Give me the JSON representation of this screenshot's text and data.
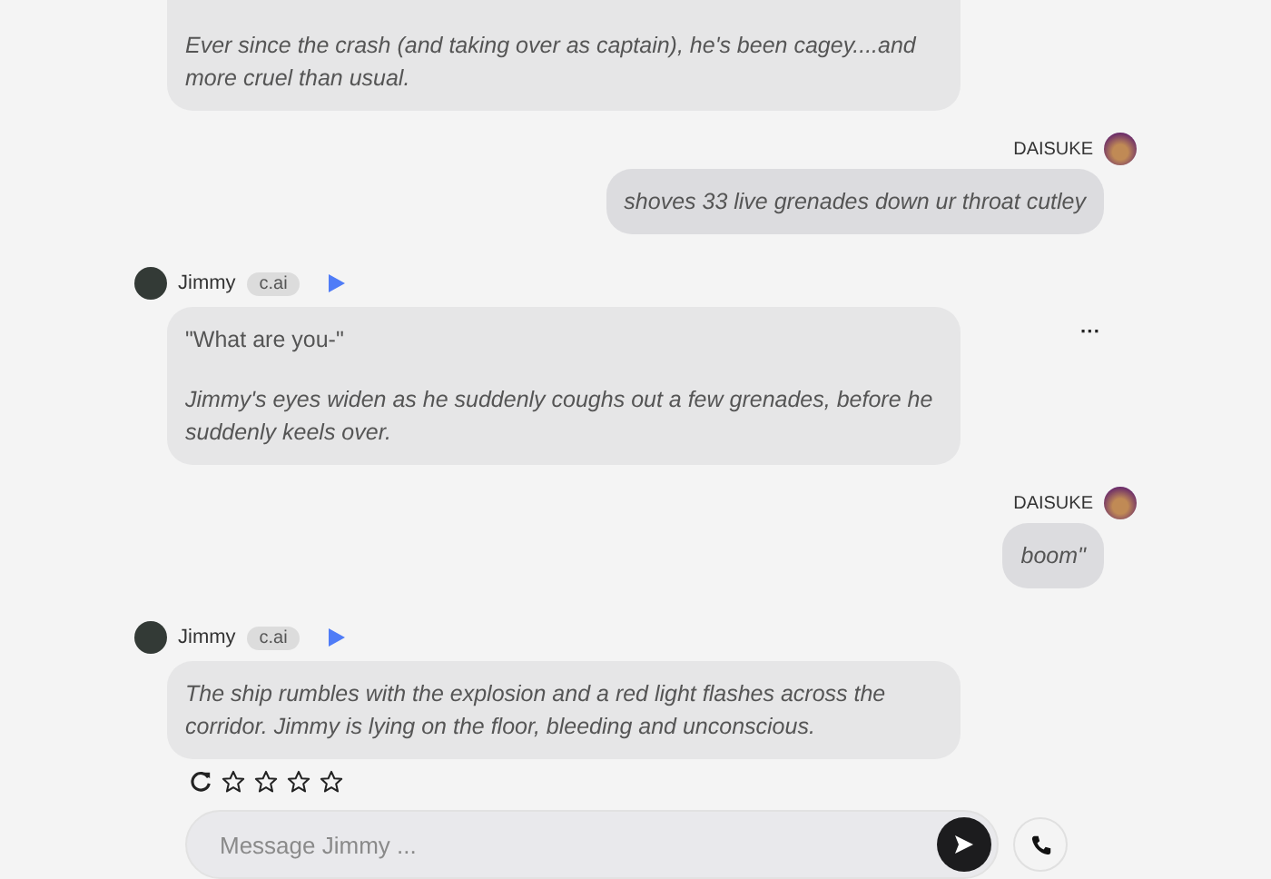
{
  "messages": [
    {
      "kind": "bot",
      "paragraphs": [
        {
          "kind": "narration",
          "text": "Ever since the crash (and taking over as captain), he's been cagey....and more cruel than usual."
        }
      ]
    },
    {
      "kind": "user",
      "name": "DAISUKE",
      "paragraphs": [
        {
          "kind": "narration",
          "text": "shoves 33 live grenades down ur throat cutley"
        }
      ]
    },
    {
      "kind": "bot",
      "name": "Jimmy",
      "badge": "c.ai",
      "menu": "···",
      "paragraphs": [
        {
          "kind": "speech",
          "text": "\"What are you-\""
        },
        {
          "kind": "narration",
          "text": "Jimmy's eyes widen as he suddenly coughs out a few grenades, before he suddenly keels over."
        }
      ]
    },
    {
      "kind": "user",
      "name": "DAISUKE",
      "paragraphs": [
        {
          "kind": "narration",
          "text": "boom\""
        }
      ]
    },
    {
      "kind": "bot",
      "name": "Jimmy",
      "badge": "c.ai",
      "paragraphs": [
        {
          "kind": "narration",
          "text": "The ship rumbles with the explosion and a red light flashes across the corridor. Jimmy is lying on the floor, bleeding and unconscious."
        }
      ],
      "stars": 0
    }
  ],
  "composer": {
    "placeholder": "Message Jimmy ..."
  }
}
